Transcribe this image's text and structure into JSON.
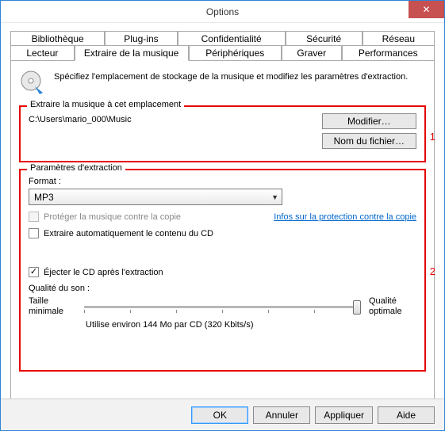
{
  "window": {
    "title": "Options"
  },
  "tabs": {
    "top": [
      "Bibliothèque",
      "Plug-ins",
      "Confidentialité",
      "Sécurité",
      "Réseau"
    ],
    "bot": [
      "Lecteur",
      "Extraire de la musique",
      "Périphériques",
      "Graver",
      "Performances"
    ],
    "active": "Extraire de la musique"
  },
  "intro": {
    "text": "Spécifiez l'emplacement de stockage de la musique et modifiez les paramètres d'extraction."
  },
  "group1": {
    "legend": "Extraire la musique à cet emplacement",
    "path": "C:\\Users\\mario_000\\Music",
    "modify": "Modifier…",
    "filename": "Nom du fichier…",
    "marker": "1"
  },
  "group2": {
    "legend": "Paramètres d'extraction",
    "format_label": "Format :",
    "format_value": "MP3",
    "protect_label": "Protéger la musique contre la copie",
    "protect_link": "Infos sur la protection contre la copie",
    "autorip_label": "Extraire automatiquement le contenu du CD",
    "eject_label": "Éjecter le CD après l'extraction",
    "quality_label": "Qualité du son :",
    "q_min": "Taille minimale",
    "q_max": "Qualité optimale",
    "estimate": "Utilise environ 144 Mo par CD (320 Kbits/s)",
    "marker": "2"
  },
  "footer": {
    "ok": "OK",
    "cancel": "Annuler",
    "apply": "Appliquer",
    "help": "Aide"
  }
}
